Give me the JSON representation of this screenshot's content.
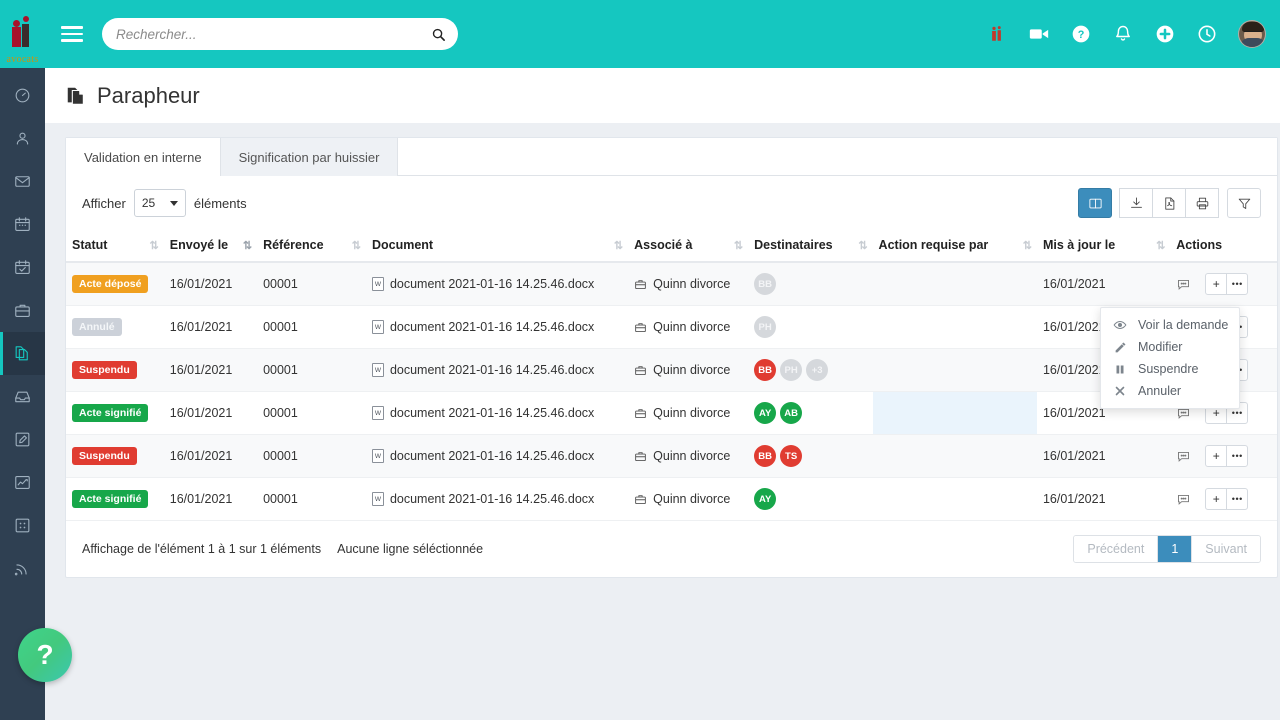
{
  "brand": {
    "logo_word": "avocats",
    "teal": "#15c7c0",
    "sidebar_bg": "#2f4052"
  },
  "topbar": {
    "menu_toggle": "menu-toggle",
    "search_placeholder": "Rechercher...",
    "search_value": "",
    "icons": [
      "lawyers-icon",
      "video-camera-icon",
      "help-circle-icon",
      "bell-icon",
      "plus-circle-icon",
      "clock-icon",
      "user-avatar"
    ]
  },
  "sidebar": {
    "items": [
      {
        "name": "dashboard",
        "icon": "gauge-icon",
        "active": false
      },
      {
        "name": "contacts",
        "icon": "user-icon",
        "active": false
      },
      {
        "name": "messages",
        "icon": "envelope-icon",
        "active": false
      },
      {
        "name": "calendar",
        "icon": "calendar-icon",
        "active": false
      },
      {
        "name": "tasks",
        "icon": "calendar-check-icon",
        "active": false
      },
      {
        "name": "cases",
        "icon": "briefcase-icon",
        "active": false
      },
      {
        "name": "parapheur",
        "icon": "documents-icon",
        "active": true
      },
      {
        "name": "archive",
        "icon": "inbox-icon",
        "active": false
      },
      {
        "name": "notes",
        "icon": "edit-square-icon",
        "active": false
      },
      {
        "name": "reports",
        "icon": "chart-line-icon",
        "active": false
      },
      {
        "name": "modules",
        "icon": "grid-icon",
        "active": false
      },
      {
        "name": "feed",
        "icon": "rss-icon",
        "active": false
      }
    ],
    "help_label": "?"
  },
  "page": {
    "title": "Parapheur",
    "title_icon": "documents-icon"
  },
  "tabs": [
    {
      "label": "Validation en interne",
      "active": true
    },
    {
      "label": "Signification par huissier",
      "active": false
    }
  ],
  "controls": {
    "show_label": "Afficher",
    "page_size": "25",
    "items_label": "éléments",
    "buttons": [
      {
        "name": "columns-button",
        "icon": "columns-icon",
        "primary": true
      },
      {
        "name": "download-button",
        "icon": "download-icon",
        "primary": false
      },
      {
        "name": "pdf-export-button",
        "icon": "pdf-file-icon",
        "primary": false
      },
      {
        "name": "print-button",
        "icon": "printer-icon",
        "primary": false
      },
      {
        "name": "filter-button",
        "icon": "funnel-icon",
        "primary": false
      }
    ]
  },
  "table": {
    "columns": [
      {
        "label": "Statut",
        "sortable": true,
        "sorted": false
      },
      {
        "label": "Envoyé le",
        "sortable": true,
        "sorted": true
      },
      {
        "label": "Référence",
        "sortable": true,
        "sorted": false
      },
      {
        "label": "Document",
        "sortable": true,
        "sorted": false
      },
      {
        "label": "Associé à",
        "sortable": true,
        "sorted": false
      },
      {
        "label": "Destinataires",
        "sortable": true,
        "sorted": false
      },
      {
        "label": "Action requise par",
        "sortable": true,
        "sorted": false
      },
      {
        "label": "Mis à jour le",
        "sortable": true,
        "sorted": false
      },
      {
        "label": "Actions",
        "sortable": false,
        "sorted": false
      }
    ],
    "rows": [
      {
        "status": "Acte déposé",
        "status_color": "#f0a020",
        "sent_on": "16/01/2021",
        "reference": "00001",
        "document": "document 2021-01-16 14.25.46.docx",
        "associated": "Quinn divorce",
        "recipients": [
          {
            "initials": "BB",
            "color": "#d5d8dc"
          }
        ],
        "action_required_by": "",
        "updated_on": "16/01/2021",
        "comment_icon": "comment-icon",
        "highlight_action_cell": false
      },
      {
        "status": "Annulé",
        "status_color": "#ccd1d9",
        "sent_on": "16/01/2021",
        "reference": "00001",
        "document": "document 2021-01-16 14.25.46.docx",
        "associated": "Quinn divorce",
        "recipients": [
          {
            "initials": "PH",
            "color": "#d5d8dc"
          }
        ],
        "action_required_by": "",
        "updated_on": "16/01/2021",
        "comment_icon": "comment-icon",
        "highlight_action_cell": false
      },
      {
        "status": "Suspendu",
        "status_color": "#e03c31",
        "sent_on": "16/01/2021",
        "reference": "00001",
        "document": "document 2021-01-16 14.25.46.docx",
        "associated": "Quinn divorce",
        "recipients": [
          {
            "initials": "BB",
            "color": "#e03c31"
          },
          {
            "initials": "PH",
            "color": "#d5d8dc"
          },
          {
            "initials": "+3",
            "color": "#d5d8dc"
          }
        ],
        "action_required_by": "",
        "updated_on": "16/01/2021",
        "comment_icon": "comment-icon",
        "highlight_action_cell": false
      },
      {
        "status": "Acte signifié",
        "status_color": "#17a74a",
        "sent_on": "16/01/2021",
        "reference": "00001",
        "document": "document 2021-01-16 14.25.46.docx",
        "associated": "Quinn divorce",
        "recipients": [
          {
            "initials": "AY",
            "color": "#17a74a"
          },
          {
            "initials": "AB",
            "color": "#17a74a"
          }
        ],
        "action_required_by": "",
        "updated_on": "16/01/2021",
        "comment_icon": "comment-icon",
        "highlight_action_cell": true
      },
      {
        "status": "Suspendu",
        "status_color": "#e03c31",
        "sent_on": "16/01/2021",
        "reference": "00001",
        "document": "document 2021-01-16 14.25.46.docx",
        "associated": "Quinn divorce",
        "recipients": [
          {
            "initials": "BB",
            "color": "#e03c31"
          },
          {
            "initials": "TS",
            "color": "#e03c31"
          }
        ],
        "action_required_by": "",
        "updated_on": "16/01/2021",
        "comment_icon": "comment-icon",
        "highlight_action_cell": false
      },
      {
        "status": "Acte signifié",
        "status_color": "#17a74a",
        "sent_on": "16/01/2021",
        "reference": "00001",
        "document": "document 2021-01-16 14.25.46.docx",
        "associated": "Quinn divorce",
        "recipients": [
          {
            "initials": "AY",
            "color": "#17a74a"
          }
        ],
        "action_required_by": "",
        "updated_on": "16/01/2021",
        "comment_icon": "comment-icon",
        "highlight_action_cell": false
      }
    ],
    "row_action_add": "+",
    "row_action_more": "•••"
  },
  "footer": {
    "showing": "Affichage de l'élément 1 à 1 sur 1 éléments",
    "selection": "Aucune ligne séléctionnée",
    "prev": "Précédent",
    "current_page": "1",
    "next": "Suivant"
  },
  "dropdown": {
    "items": [
      {
        "label": "Voir la demande",
        "icon": "eye-icon"
      },
      {
        "label": "Modifier",
        "icon": "pencil-icon"
      },
      {
        "label": "Suspendre",
        "icon": "pause-icon"
      },
      {
        "label": "Annuler",
        "icon": "close-x-icon"
      }
    ]
  }
}
